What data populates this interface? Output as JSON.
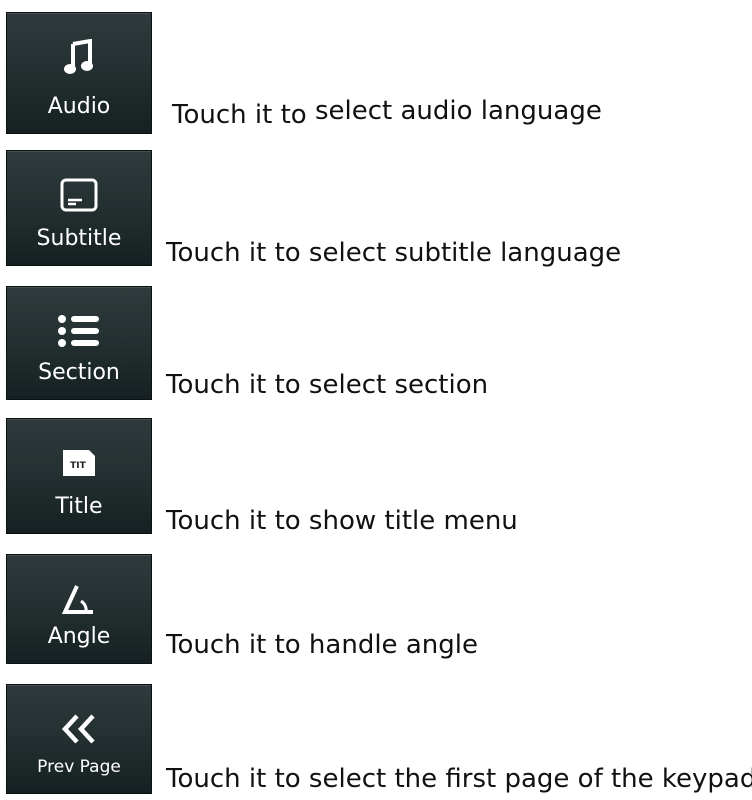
{
  "buttons": [
    {
      "id": "audio",
      "label": "Audio",
      "icon": "music-note-icon",
      "desc_a": "Touch it to",
      "desc_b": "select audio language"
    },
    {
      "id": "subtitle",
      "label": "Subtitle",
      "icon": "subtitle-icon",
      "desc": "Touch it to select subtitle language"
    },
    {
      "id": "section",
      "label": "Section",
      "icon": "list-icon",
      "desc": "Touch it to select section"
    },
    {
      "id": "title",
      "label": "Title",
      "icon": "title-card-icon",
      "icon_text": "TIT",
      "desc": "Touch it to show title menu"
    },
    {
      "id": "angle",
      "label": "Angle",
      "icon": "angle-icon",
      "desc": "Touch it to handle angle"
    },
    {
      "id": "prev-page",
      "label": "Prev Page",
      "icon": "double-chevron-left-icon",
      "desc": "Touch it to select the first page of the keypad"
    }
  ],
  "colors": {
    "button_top": "#2e3a3b",
    "button_bottom": "#162022",
    "text": "#111111"
  }
}
